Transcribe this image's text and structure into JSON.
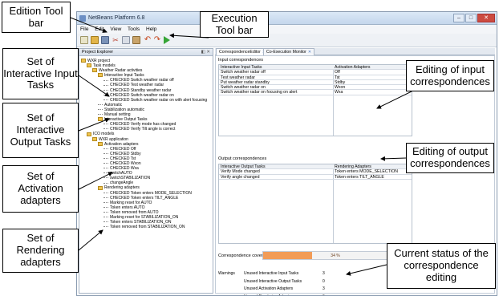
{
  "window": {
    "title": "NetBeans Platform 6.8",
    "controls": [
      "–",
      "□",
      "✕"
    ]
  },
  "menubar": [
    "File",
    "Edit",
    "View",
    "Tools",
    "Help"
  ],
  "explorer": {
    "title": "Project Explorer",
    "controls": "◧ ✕",
    "items": [
      {
        "label": "WXR project",
        "depth": 0,
        "kind": "folder"
      },
      {
        "label": "Task models",
        "depth": 1,
        "kind": "folder"
      },
      {
        "label": "Weather Radar activities",
        "depth": 2,
        "kind": "folder"
      },
      {
        "label": "Interactive Input Tasks",
        "depth": 3,
        "kind": "folder"
      },
      {
        "label": "CHECKED Switch weather radar off",
        "depth": 4,
        "kind": "leaf"
      },
      {
        "label": "CHECKED Test weather radar",
        "depth": 4,
        "kind": "leaf"
      },
      {
        "label": "CHECKED Standby weather radar",
        "depth": 4,
        "kind": "leaf"
      },
      {
        "label": "CHECKED Switch weather radar on",
        "depth": 4,
        "kind": "leaf"
      },
      {
        "label": "CHECKED Switch weather radar on with alert focusing",
        "depth": 4,
        "kind": "leaf"
      },
      {
        "label": "Automatic",
        "depth": 3,
        "kind": "leaf"
      },
      {
        "label": "Stabilization automatic",
        "depth": 3,
        "kind": "leaf"
      },
      {
        "label": "Manual setting",
        "depth": 3,
        "kind": "leaf"
      },
      {
        "label": "Interactive Output Tasks",
        "depth": 3,
        "kind": "folder"
      },
      {
        "label": "CHECKED Verify mode has changed",
        "depth": 4,
        "kind": "leaf"
      },
      {
        "label": "CHECKED Verify Tilt angle is correct",
        "depth": 4,
        "kind": "leaf"
      },
      {
        "label": "ICO models",
        "depth": 1,
        "kind": "folder"
      },
      {
        "label": "WXR application",
        "depth": 2,
        "kind": "folder"
      },
      {
        "label": "Activation adapters",
        "depth": 3,
        "kind": "folder"
      },
      {
        "label": "CHECKED Off",
        "depth": 4,
        "kind": "leaf"
      },
      {
        "label": "CHECKED Stdby",
        "depth": 4,
        "kind": "leaf"
      },
      {
        "label": "CHECKED Tst",
        "depth": 4,
        "kind": "leaf"
      },
      {
        "label": "CHECKED Wxon",
        "depth": 4,
        "kind": "leaf"
      },
      {
        "label": "CHECKED Wxa",
        "depth": 4,
        "kind": "leaf"
      },
      {
        "label": "switchAUTO",
        "depth": 4,
        "kind": "leaf"
      },
      {
        "label": "switchSTABILIZATION",
        "depth": 4,
        "kind": "leaf"
      },
      {
        "label": "changeAngle",
        "depth": 4,
        "kind": "leaf"
      },
      {
        "label": "Rendering adapters",
        "depth": 3,
        "kind": "folder"
      },
      {
        "label": "CHECKED Token enters MODE_SELECTION",
        "depth": 4,
        "kind": "leaf"
      },
      {
        "label": "CHECKED Token enters TILT_ANGLE",
        "depth": 4,
        "kind": "leaf"
      },
      {
        "label": "Marking reset for AUTO",
        "depth": 4,
        "kind": "leaf"
      },
      {
        "label": "Token enters AUTO",
        "depth": 4,
        "kind": "leaf"
      },
      {
        "label": "Token removed from AUTO",
        "depth": 4,
        "kind": "leaf"
      },
      {
        "label": "Marking reset for STABILIZATION_ON",
        "depth": 4,
        "kind": "leaf"
      },
      {
        "label": "Token enters STABILIZATION_ON",
        "depth": 4,
        "kind": "leaf"
      },
      {
        "label": "Token removed from STABILIZATION_ON",
        "depth": 4,
        "kind": "leaf"
      }
    ]
  },
  "tabs": [
    {
      "label": "CorrespondenceEditor",
      "active": true
    },
    {
      "label": "Co-Execution Monitor",
      "active": false
    }
  ],
  "input_correspondences": {
    "title": "Input correspondences",
    "col1": "Interactive Input Tasks",
    "col2": "Activation Adapters",
    "rows": [
      [
        "Switch weather radar off",
        "Off"
      ],
      [
        "Test weather radar",
        "Tst"
      ],
      [
        "Put weather radar standby",
        "Stdby"
      ],
      [
        "Switch weather radar on",
        "Wxon"
      ],
      [
        "Switch weather radar on focusing on alert",
        "Wxa"
      ]
    ]
  },
  "output_correspondences": {
    "title": "Output correspondences",
    "col1": "Interactive Output Tasks",
    "col2": "Rendering Adapters",
    "rows": [
      [
        "Verify Mode changed",
        "Token enters MODE_SELECTION"
      ],
      [
        "Verify angle changed",
        "Token enters TILT_ANGLE"
      ]
    ]
  },
  "coverage": {
    "label": "Correspondence coverage",
    "percent": 34,
    "percent_text": "34 %"
  },
  "warnings": {
    "label": "Warnings",
    "rows": [
      {
        "label": "Unused Interactive Input Tasks",
        "value": "3"
      },
      {
        "label": "Unused Interactive Output Tasks",
        "value": "0"
      },
      {
        "label": "Unused Activation Adapters",
        "value": "3"
      },
      {
        "label": "Unused Rendering Adapters",
        "value": "6"
      }
    ]
  },
  "callouts": {
    "edition_toolbar": "Edition Tool bar",
    "execution_toolbar": "Execution Tool bar",
    "interactive_input": "Set of Interactive Input Tasks",
    "interactive_output": "Set of Interactive Output Tasks",
    "activation": "Set of Activation adapters",
    "rendering": "Set of Rendering adapters",
    "editing_input": "Editing of input correspondences",
    "editing_output": "Editing of output correspondences",
    "current_status": "Current status of the correspondence editing"
  }
}
